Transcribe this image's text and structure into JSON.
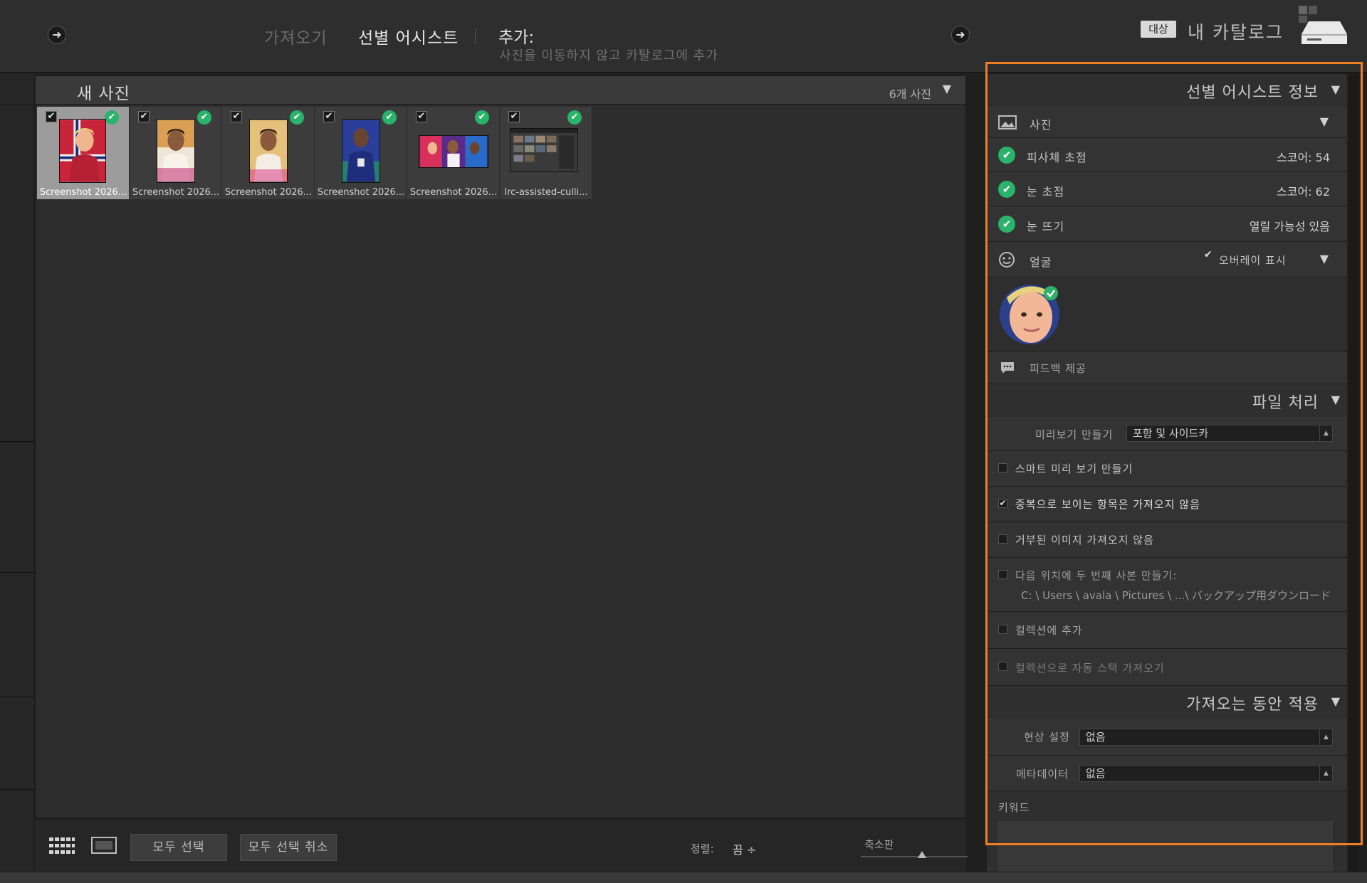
{
  "header": {
    "nav_import": "가져오기",
    "nav_cull": "선별 어시스트",
    "add_label": "추가:",
    "add_sub": "사진을 이동하지 않고 카탈로그에 추가",
    "dest_badge": "대상",
    "dest_name": "내 카탈로그"
  },
  "grid": {
    "title": "새 사진",
    "count": "6개 사진",
    "thumbnails": [
      {
        "caption": "Screenshot 2026...",
        "selected": true
      },
      {
        "caption": "Screenshot 2026...",
        "selected": false
      },
      {
        "caption": "Screenshot 2026...",
        "selected": false
      },
      {
        "caption": "Screenshot 2026...",
        "selected": false
      },
      {
        "caption": "Screenshot 2026...",
        "selected": false
      },
      {
        "caption": "lrc-assisted-culli...",
        "selected": false
      }
    ]
  },
  "toolbar": {
    "select_all": "모두 선택",
    "deselect_all": "모두 선택 취소",
    "sort_label": "정렬:",
    "sort_value": "끔 ÷",
    "thumbnail_label": "축소판"
  },
  "cull_info": {
    "title": "선별 어시스트 정보",
    "photo_label": "사진",
    "subject_focus": {
      "label": "피사체 초점",
      "value": "스코어: 54"
    },
    "eye_focus": {
      "label": "눈 초점",
      "value": "스코어: 62"
    },
    "eye_open": {
      "label": "눈 뜨기",
      "value": "열릴 가능성 있음"
    },
    "face_label": "얼굴",
    "overlay_label": "오버레이 표시",
    "feedback_label": "피드백 제공"
  },
  "file_handling": {
    "title": "파일 처리",
    "preview_label": "미리보기 만들기",
    "preview_value": "포함 및 사이드카",
    "smart_preview": "스마트 미리 보기 만들기",
    "no_duplicates": "중복으로 보이는 항목은 가져오지 않음",
    "no_rejected": "거부된 이미지 가져오지 않음",
    "second_copy": "다음 위치에 두 번째 사본 만들기:",
    "second_copy_path": "C: \\ Users \\ avala \\ Pictures \\ ...\\ バックアップ用ダウンロード",
    "add_collection": "컬렉션에 추가",
    "auto_stack": "컬렉션으로 자동 스택 가져오기"
  },
  "apply_during_import": {
    "title": "가져오는 동안 적용",
    "develop_label": "현상 설정",
    "develop_value": "없음",
    "metadata_label": "메타데이터",
    "metadata_value": "없음",
    "keywords_label": "키워드"
  },
  "colors": {
    "highlight": "#f07f22",
    "check_green": "#2bb36b"
  }
}
